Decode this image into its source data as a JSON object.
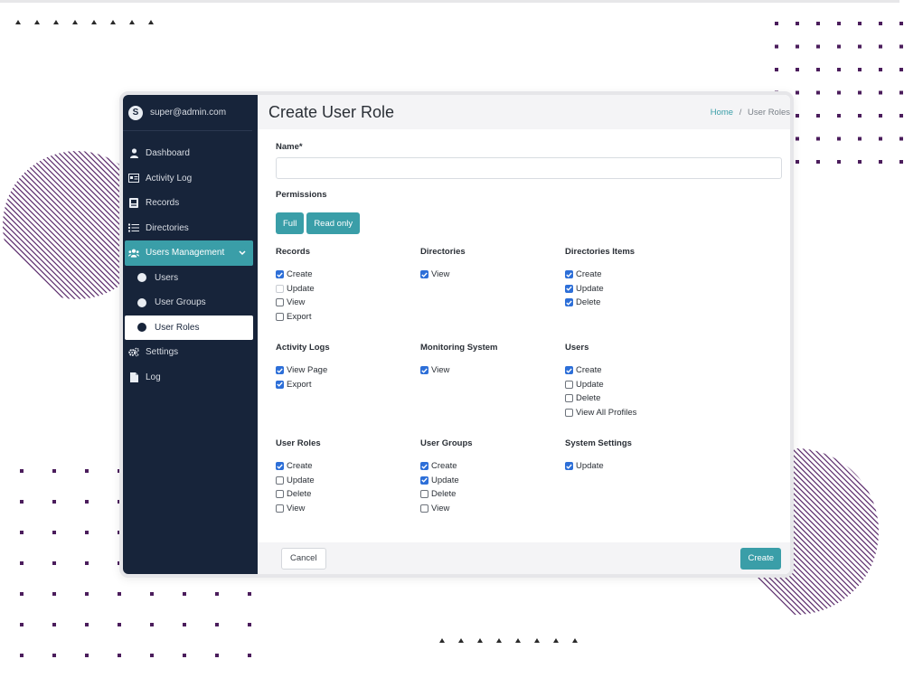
{
  "sidebar": {
    "avatar_letter": "S",
    "user_email": "super@admin.com",
    "items": [
      {
        "label": "Dashboard",
        "icon": "user-icon"
      },
      {
        "label": "Activity Log",
        "icon": "id-card-icon"
      },
      {
        "label": "Records",
        "icon": "record-icon"
      },
      {
        "label": "Directories",
        "icon": "list-icon"
      },
      {
        "label": "Users Management",
        "icon": "users-icon",
        "active": true
      },
      {
        "label": "Settings",
        "icon": "gears-icon"
      },
      {
        "label": "Log",
        "icon": "file-icon"
      }
    ],
    "subitems": [
      {
        "label": "Users"
      },
      {
        "label": "User Groups"
      },
      {
        "label": "User Roles",
        "current": true
      }
    ]
  },
  "header": {
    "title": "Create User Role",
    "breadcrumb_home": "Home",
    "breadcrumb_sep": "/",
    "breadcrumb_current": "User Roles"
  },
  "form": {
    "name_label": "Name*",
    "name_value": "",
    "permissions_label": "Permissions",
    "full_button": "Full",
    "readonly_button": "Read only"
  },
  "groups": [
    {
      "title": "Records",
      "items": [
        {
          "label": "Create",
          "checked": true
        },
        {
          "label": "Update",
          "checked": false,
          "disabled": true
        },
        {
          "label": "View",
          "checked": false
        },
        {
          "label": "Export",
          "checked": false
        }
      ]
    },
    {
      "title": "Directories",
      "items": [
        {
          "label": "View",
          "checked": true
        }
      ]
    },
    {
      "title": "Directories Items",
      "items": [
        {
          "label": "Create",
          "checked": true
        },
        {
          "label": "Update",
          "checked": true
        },
        {
          "label": "Delete",
          "checked": true
        }
      ]
    },
    {
      "title": "Activity Logs",
      "items": [
        {
          "label": "View Page",
          "checked": true
        },
        {
          "label": "Export",
          "checked": true
        }
      ]
    },
    {
      "title": "Monitoring System",
      "items": [
        {
          "label": "View",
          "checked": true
        }
      ]
    },
    {
      "title": "Users",
      "items": [
        {
          "label": "Create",
          "checked": true
        },
        {
          "label": "Update",
          "checked": false
        },
        {
          "label": "Delete",
          "checked": false
        },
        {
          "label": "View All Profiles",
          "checked": false
        }
      ]
    },
    {
      "title": "User Roles",
      "items": [
        {
          "label": "Create",
          "checked": true
        },
        {
          "label": "Update",
          "checked": false
        },
        {
          "label": "Delete",
          "checked": false
        },
        {
          "label": "View",
          "checked": false
        }
      ]
    },
    {
      "title": "User Groups",
      "items": [
        {
          "label": "Create",
          "checked": true
        },
        {
          "label": "Update",
          "checked": true
        },
        {
          "label": "Delete",
          "checked": false
        },
        {
          "label": "View",
          "checked": false
        }
      ]
    },
    {
      "title": "System Settings",
      "items": [
        {
          "label": "Update",
          "checked": true
        }
      ]
    }
  ],
  "footer": {
    "cancel_label": "Cancel",
    "create_label": "Create"
  },
  "colors": {
    "sidebar_bg": "#17243a",
    "accent": "#3a9ea8",
    "checkbox": "#2d6fd8",
    "decor_purple": "#4b1d5c"
  }
}
